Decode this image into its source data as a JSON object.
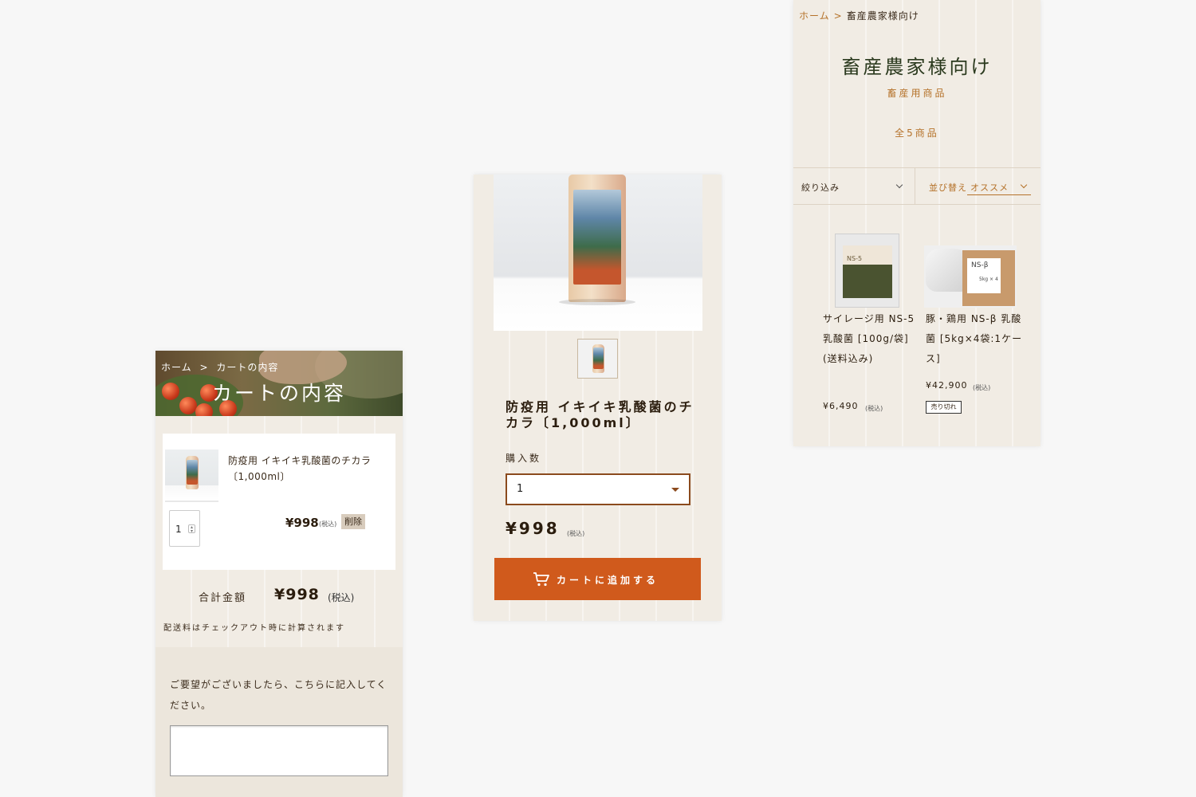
{
  "cart": {
    "breadcrumb": {
      "home": "ホーム",
      "sep": ">",
      "current": "カートの内容"
    },
    "title": "カートの内容",
    "item": {
      "name": "防疫用 イキイキ乳酸菌のチカラ〔1,000ml〕",
      "quantity": "1",
      "price": "¥998",
      "tax": "(税込)",
      "delete_label": "削除"
    },
    "total_label": "合計金額",
    "total_price": "¥998",
    "total_tax": "(税込)",
    "shipping_note": "配送料はチェックアウト時に計算されます",
    "note_prompt": "ご要望がございましたら、こちらに記入してください。",
    "note_value": ""
  },
  "product": {
    "title": "防疫用 イキイキ乳酸菌のチカラ〔1,000ml〕",
    "quantity_label": "購入数",
    "quantity_selected": "1",
    "price": "¥998",
    "tax": "(税込)",
    "add_to_cart": "カートに追加する"
  },
  "category": {
    "breadcrumb": {
      "home": "ホーム",
      "sep": ">",
      "current": "畜産農家様向け"
    },
    "title": "畜産農家様向け",
    "subtitle": "畜産用商品",
    "count": "全5商品",
    "filter_label": "絞り込み",
    "sort_label": "並び替え",
    "sort_selected": "オススメ",
    "products": [
      {
        "name": "サイレージ用 NS-5 乳酸菌 [100g/袋] (送料込み)",
        "price": "¥6,490",
        "tax": "(税込)"
      },
      {
        "name": "豚・鶏用 NS-β 乳酸菌 [5kg×4袋:1ケース]",
        "price": "¥42,900",
        "tax": "(税込)",
        "badge": "売り切れ"
      }
    ],
    "images": {
      "ns5_label": "NS-5",
      "nsb_label": "NS-β",
      "nsb_sub": "5kg × 4"
    }
  },
  "colors": {
    "panel_bg": "#f1ece4",
    "accent_orange": "#d05a1c",
    "accent_brown": "#b5722a",
    "select_border": "#8b4a1d",
    "page_bg": "#f7f7f7"
  }
}
